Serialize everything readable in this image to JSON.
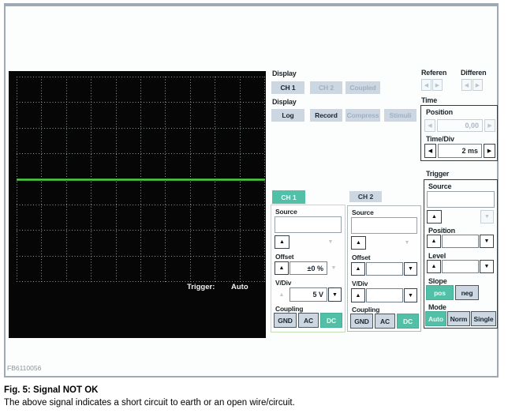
{
  "frame": {
    "watermark": "FB6110056"
  },
  "caption": {
    "title": "Fig. 5: Signal NOT OK",
    "body": "The above signal indicates a short circuit to earth or an open wire/circuit."
  },
  "icons": {
    "up": "▲",
    "down": "▼",
    "left": "◀",
    "right": "▶"
  },
  "scope": {
    "trigger_label": "Trigger:",
    "trigger_mode": "Auto",
    "grid": {
      "cols": 10,
      "rows": 8,
      "trace_row": 4
    },
    "trace_color": "#46d53c",
    "grid_color": "#909b9b",
    "background": "#060606"
  },
  "display_channels": {
    "label": "Display",
    "buttons": [
      {
        "label": "CH 1",
        "state": "active"
      },
      {
        "label": "CH 2",
        "state": "disabled"
      },
      {
        "label": "Coupled",
        "state": "disabled"
      }
    ]
  },
  "display_modes": {
    "label": "Display",
    "buttons": [
      {
        "label": "Log",
        "state": "active"
      },
      {
        "label": "Record",
        "state": "active"
      },
      {
        "label": "Compress",
        "state": "disabled"
      },
      {
        "label": "Stimuli",
        "state": "disabled"
      }
    ]
  },
  "reference": {
    "label": "Referen"
  },
  "differential": {
    "label": "Differen"
  },
  "time": {
    "label": "Time",
    "position_label": "Position",
    "position_value": "0,00",
    "timediv_label": "Time/Div",
    "timediv_value": "2 ms"
  },
  "trigger": {
    "label": "Trigger",
    "source_label": "Source",
    "source_value": "",
    "position_label": "Position",
    "position_value": "",
    "level_label": "Level",
    "level_value": "",
    "slope_label": "Slope",
    "slope_buttons": [
      {
        "label": "pos",
        "state": "active"
      },
      {
        "label": "neg",
        "state": "inactive"
      }
    ],
    "mode_label": "Mode",
    "mode_buttons": [
      {
        "label": "Auto",
        "state": "active"
      },
      {
        "label": "Norm",
        "state": "inactive"
      },
      {
        "label": "Single",
        "state": "inactive"
      }
    ]
  },
  "channels": [
    {
      "tab": "CH 1",
      "source_label": "Source",
      "source_value": "",
      "offset_label": "Offset",
      "offset_value": "±0 %",
      "vdiv_label": "V/Div",
      "vdiv_value": "5 V",
      "coupling_label": "Coupling",
      "coupling_buttons": [
        {
          "label": "GND",
          "state": "inactive"
        },
        {
          "label": "AC",
          "state": "inactive"
        },
        {
          "label": "DC",
          "state": "active"
        }
      ]
    },
    {
      "tab": "CH 2",
      "source_label": "Source",
      "source_value": "",
      "offset_label": "Offset",
      "offset_value": "",
      "vdiv_label": "V/Div",
      "vdiv_value": "",
      "coupling_label": "Coupling",
      "coupling_buttons": [
        {
          "label": "GND",
          "state": "inactive"
        },
        {
          "label": "AC",
          "state": "inactive"
        },
        {
          "label": "DC",
          "state": "active"
        }
      ]
    }
  ],
  "colors": {
    "accent_teal": "#52bfa7",
    "button_gray": "#ccd7e2",
    "disabled_text": "#9fb0c4",
    "trace_green": "#46d53c",
    "frame_border": "#9fa9b5"
  }
}
